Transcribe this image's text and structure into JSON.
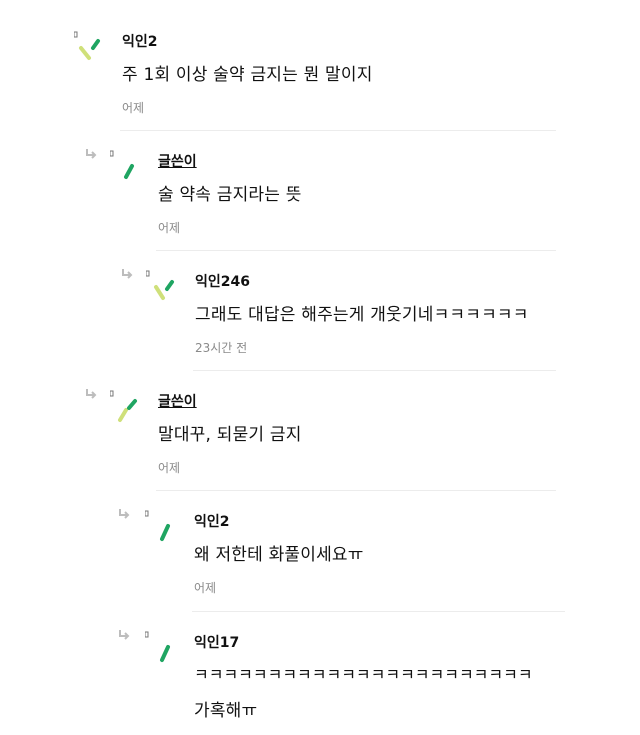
{
  "comments": [
    {
      "author": "익인2",
      "text": "주 1회 이상 술약 금지는 뭔 말이지",
      "time": "어제",
      "is_op": false,
      "depth": 0
    },
    {
      "author": "글쓴이",
      "text": "술 약속 금지라는 뜻",
      "time": "어제",
      "is_op": true,
      "depth": 1
    },
    {
      "author": "익인246",
      "text": "그래도 대답은 해주는게 개웃기네ㅋㅋㅋㅋㅋㅋ",
      "time": "23시간 전",
      "is_op": false,
      "depth": 2
    },
    {
      "author": "글쓴이",
      "text": "말대꾸, 되묻기 금지",
      "time": "어제",
      "is_op": true,
      "depth": 1
    },
    {
      "author": "익인2",
      "text": "왜 저한테 화풀이세요ㅠ",
      "time": "어제",
      "is_op": false,
      "depth": 2
    },
    {
      "author": "익인17",
      "text": "ㅋㅋㅋㅋㅋㅋㅋㅋㅋㅋㅋㅋㅋㅋㅋㅋㅋㅋㅋㅋㅋㅋㅋ",
      "text2": "가혹해ㅠ",
      "is_op": false,
      "depth": 2
    }
  ],
  "icons": {
    "reply_arrow": "reply-arrow-icon",
    "avatar": "anonymous-avatar-icon"
  },
  "colors": {
    "accent_green": "#1fa562",
    "accent_lime": "#cfe07a",
    "time_gray": "#8a8a8a",
    "divider": "#ececec"
  }
}
